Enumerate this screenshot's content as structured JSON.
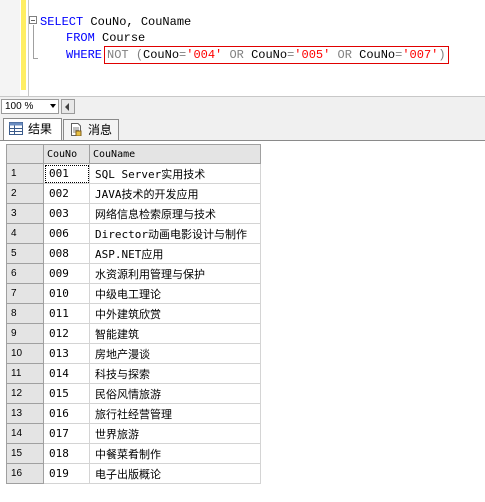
{
  "editor": {
    "line1": {
      "kw_select": "SELECT",
      "columns": " CouNo, CouName"
    },
    "line2": {
      "kw_from": "FROM",
      "table": " Course"
    },
    "line3": {
      "kw_where": "WHERE",
      "kw_not": "NOT",
      "open_paren": " (",
      "col1": "CouNo",
      "eq1": "=",
      "val1": "'004'",
      "kw_or1": " OR ",
      "col2": "CouNo",
      "eq2": "=",
      "val2": "'005'",
      "kw_or2": " OR ",
      "col3": "CouNo",
      "eq3": "=",
      "val3": "'007'",
      "close_paren": ")"
    }
  },
  "zoom": {
    "value": "100 %"
  },
  "tabs": {
    "results_label": "结果",
    "messages_label": "消息"
  },
  "grid": {
    "columns": [
      "CouNo",
      "CouName"
    ],
    "rows": [
      {
        "num": "1",
        "couno": "001",
        "couname": "SQL Server实用技术"
      },
      {
        "num": "2",
        "couno": "002",
        "couname": "JAVA技术的开发应用"
      },
      {
        "num": "3",
        "couno": "003",
        "couname": "网络信息检索原理与技术"
      },
      {
        "num": "4",
        "couno": "006",
        "couname": "Director动画电影设计与制作"
      },
      {
        "num": "5",
        "couno": "008",
        "couname": "ASP.NET应用"
      },
      {
        "num": "6",
        "couno": "009",
        "couname": "水资源利用管理与保护"
      },
      {
        "num": "7",
        "couno": "010",
        "couname": "中级电工理论"
      },
      {
        "num": "8",
        "couno": "011",
        "couname": "中外建筑欣赏"
      },
      {
        "num": "9",
        "couno": "012",
        "couname": "智能建筑"
      },
      {
        "num": "10",
        "couno": "013",
        "couname": "房地产漫谈"
      },
      {
        "num": "11",
        "couno": "014",
        "couname": "科技与探索"
      },
      {
        "num": "12",
        "couno": "015",
        "couname": "民俗风情旅游"
      },
      {
        "num": "13",
        "couno": "016",
        "couname": "旅行社经营管理"
      },
      {
        "num": "14",
        "couno": "017",
        "couname": "世界旅游"
      },
      {
        "num": "15",
        "couno": "018",
        "couname": "中餐菜肴制作"
      },
      {
        "num": "16",
        "couno": "019",
        "couname": "电子出版概论"
      }
    ]
  },
  "colors": {
    "keyword": "#0000ff",
    "operator": "#808080",
    "string": "#ff0000",
    "highlight_border": "#e00000",
    "change_bar": "#ffee62"
  },
  "icons": {
    "results_tab": "grid-icon",
    "messages_tab": "document-icon"
  }
}
